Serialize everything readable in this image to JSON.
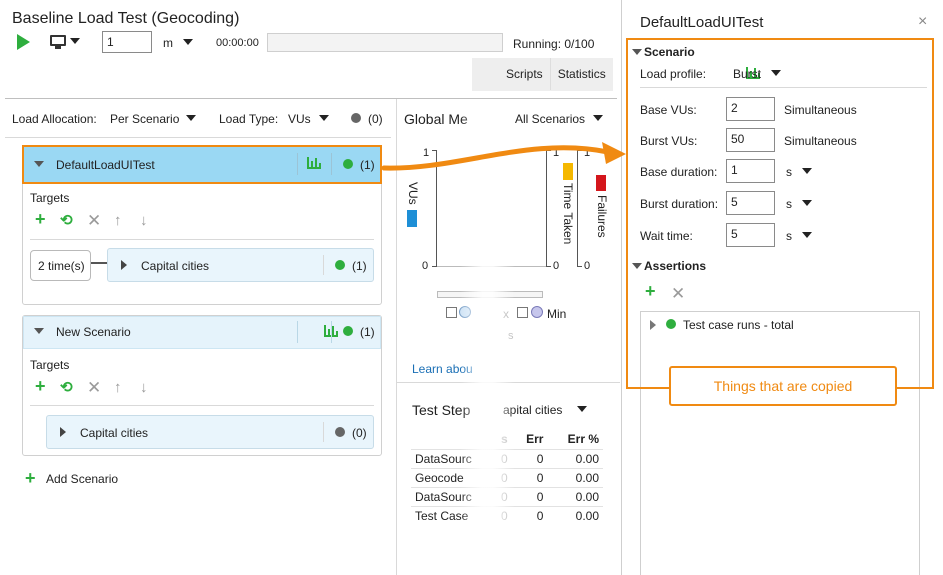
{
  "app": {
    "title": "Baseline Load Test (Geocoding)"
  },
  "toolbar": {
    "duration_value": "1",
    "duration_unit": "m",
    "elapsed": "00:00:00",
    "running": "Running: 0/100"
  },
  "tabs": [
    "Scripts",
    "Statistics"
  ],
  "allocation": {
    "label": "Load Allocation:",
    "value": "Per Scenario",
    "load_type_label": "Load Type:",
    "load_type_value": "VUs",
    "count": "(0)"
  },
  "scenarios": [
    {
      "name": "DefaultLoadUITest",
      "count": "(1)",
      "targets_label": "Targets",
      "iterations": "2 time(s)",
      "target_name": "Capital cities",
      "target_count": "(1)",
      "status_color": "#2eae3e"
    },
    {
      "name": "New Scenario",
      "count": "(1)",
      "targets_label": "Targets",
      "target_name": "Capital cities",
      "target_count": "(0)",
      "status_color": "#666666"
    }
  ],
  "add_scenario": "Add Scenario",
  "metrics": {
    "title": "Global Me",
    "filter": "All Scenarios",
    "y_left_label": "VUs",
    "y_right_label1": "Time Taken",
    "y_right_label2": "Failures",
    "tick_top": "1",
    "tick_bottom": "0",
    "legend_x": "x",
    "legend_min": "Min",
    "fragment_s": "s",
    "learn": "Learn abou"
  },
  "steps": {
    "title": "Test Step",
    "filter": "apital cities",
    "headers": [
      "s",
      "Err",
      "Err %"
    ],
    "rows": [
      {
        "name": "DataSourc",
        "s": "0",
        "err": "0",
        "pct": "0.00"
      },
      {
        "name": "Geocode",
        "s": "0",
        "err": "0",
        "pct": "0.00"
      },
      {
        "name": "DataSourc",
        "s": "0",
        "err": "0",
        "pct": "0.00"
      },
      {
        "name": "Test Case",
        "s": "0",
        "err": "0",
        "pct": "0.00"
      }
    ]
  },
  "panel": {
    "title": "DefaultLoadUITest",
    "close": "×",
    "scenario_header": "Scenario",
    "load_profile_label": "Load profile:",
    "load_profile_value": "Burst",
    "fields": [
      {
        "label": "Base VUs:",
        "value": "2",
        "unit": "Simultaneous"
      },
      {
        "label": "Burst VUs:",
        "value": "50",
        "unit": "Simultaneous"
      },
      {
        "label": "Base duration:",
        "value": "1",
        "unit": "s"
      },
      {
        "label": "Burst duration:",
        "value": "5",
        "unit": "s"
      },
      {
        "label": "Wait time:",
        "value": "5",
        "unit": "s"
      }
    ],
    "assertions_header": "Assertions",
    "assertion_item": "Test case runs - total"
  },
  "callout": "Things that are copied",
  "colors": {
    "accent_orange": "#f08a12",
    "green": "#2eae3e",
    "selected_blue": "#9ad8f3"
  }
}
